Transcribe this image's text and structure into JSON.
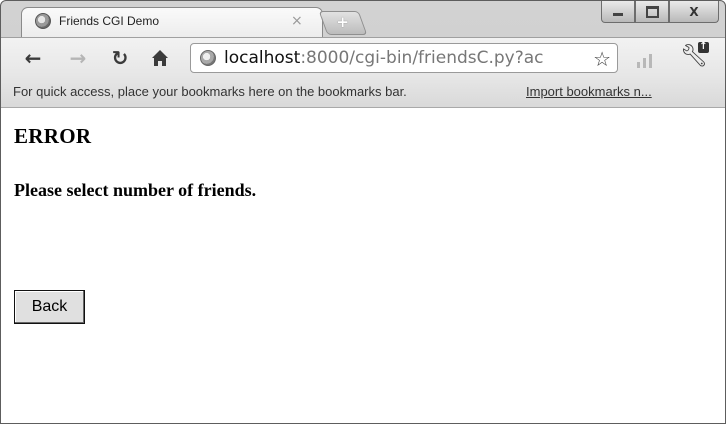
{
  "tab": {
    "title": "Friends CGI Demo",
    "close_glyph": "×",
    "favicon": "globe-icon"
  },
  "new_tab": {
    "label": "+"
  },
  "window_controls": {
    "close_glyph": "X"
  },
  "address": {
    "host": "localhost",
    "rest": ":8000/cgi-bin/friendsC.py?ac",
    "icon": "globe-icon"
  },
  "bookmarks_bar": {
    "message": "For quick access, place your bookmarks here on the bookmarks bar.",
    "import_link": "Import bookmarks n..."
  },
  "page": {
    "heading": "ERROR",
    "message": "Please select number of friends.",
    "back_label": "Back"
  }
}
